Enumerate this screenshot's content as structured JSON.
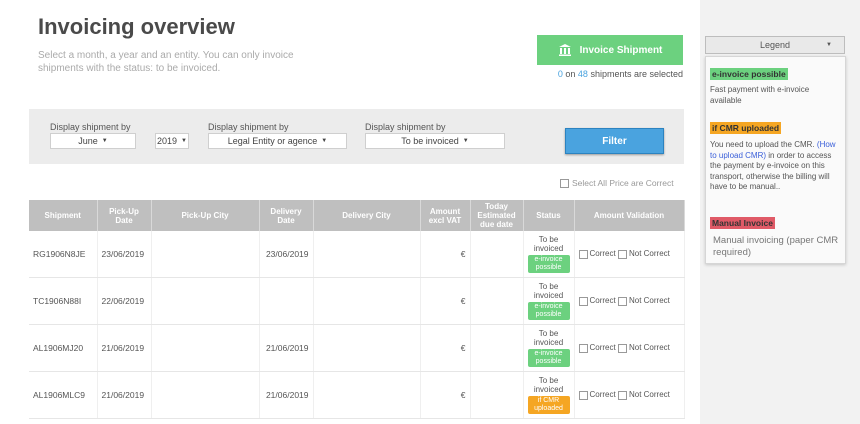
{
  "header": {
    "title": "Invoicing overview",
    "subtitle": "Select a month, a year and an entity. You can only invoice shipments with the status: to be invoiced."
  },
  "invoice_button": {
    "label": "Invoice Shipment",
    "icon": "bank-icon"
  },
  "selection": {
    "selected": "0",
    "on_label": "on",
    "total": "48",
    "suffix": "shipments are selected"
  },
  "filters": {
    "month": {
      "label": "Display shipment by",
      "value": "June"
    },
    "year": {
      "value": "2019"
    },
    "entity": {
      "label": "Display shipment by",
      "value": "Legal Entity or agence"
    },
    "status": {
      "label": "Display shipment by",
      "value": "To be invoiced"
    },
    "filter_button": "Filter"
  },
  "select_all_label": "Select All Price are Correct",
  "table": {
    "headers": [
      "Shipment",
      "Pick-Up Date",
      "Pick-Up City",
      "Delivery Date",
      "Delivery City",
      "Amount excl VAT",
      "Today Estimated due date",
      "Status",
      "Amount Validation"
    ],
    "correct_label": "Correct",
    "not_correct_label": "Not Correct",
    "rows": [
      {
        "shipment": "RG1906N8JE",
        "pickup_date": "23/06/2019",
        "pickup_city": "",
        "delivery_date": "23/06/2019",
        "delivery_city": "",
        "amount": "€",
        "due_date": "",
        "status": "To be invoiced",
        "badge": "e-invoice possible"
      },
      {
        "shipment": "TC1906N88I",
        "pickup_date": "22/06/2019",
        "pickup_city": "",
        "delivery_date": "",
        "delivery_city": "",
        "amount": "€",
        "due_date": "",
        "status": "To be invoiced",
        "badge": "e-invoice possible"
      },
      {
        "shipment": "AL1906MJ20",
        "pickup_date": "21/06/2019",
        "pickup_city": "",
        "delivery_date": "21/06/2019",
        "delivery_city": "",
        "amount": "€",
        "due_date": "",
        "status": "To be invoiced",
        "badge": "e-invoice possible"
      },
      {
        "shipment": "AL1906MLC9",
        "pickup_date": "21/06/2019",
        "pickup_city": "",
        "delivery_date": "21/06/2019",
        "delivery_city": "",
        "amount": "€",
        "due_date": "",
        "status": "To be invoiced",
        "badge": "if CMR uploaded"
      }
    ]
  },
  "legend": {
    "button_label": "Legend",
    "einvoice": {
      "tag": "e-invoice possible",
      "text": "Fast payment with e-invoice available"
    },
    "cmr": {
      "tag": "if CMR uploaded",
      "text_before": "You need to upload the CMR.",
      "link": "(How to upload CMR)",
      "text_after": "in order to access the payment by e-invoice on this transport, otherwise the billing will have to be manual.."
    },
    "manual": {
      "tag": "Manual Invoice",
      "text": "Manual invoicing (paper CMR required)"
    }
  },
  "colors": {
    "green": "#6cd17f",
    "orange": "#f5a623",
    "red": "#e05a67",
    "blue": "#4aa3df"
  }
}
